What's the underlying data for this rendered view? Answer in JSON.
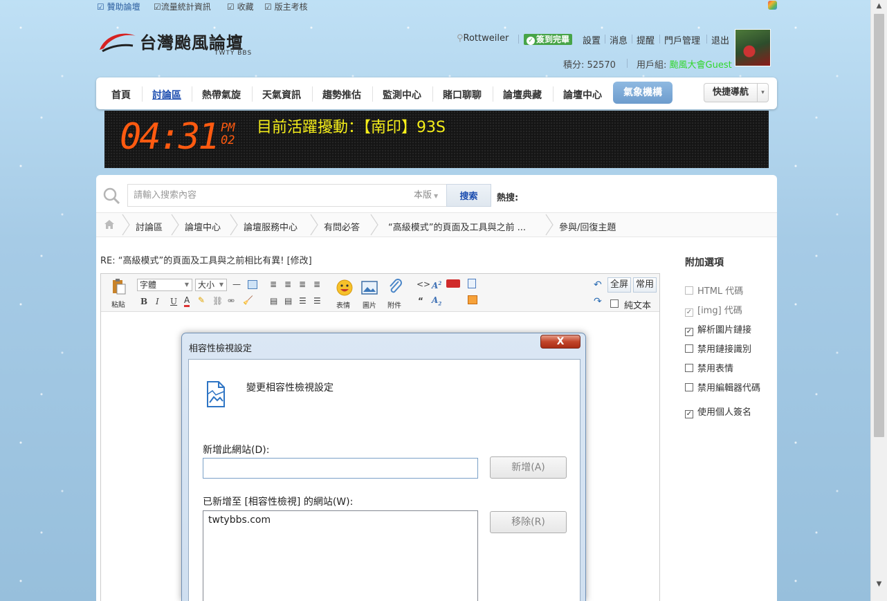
{
  "top_links": [
    {
      "label": "☑ 贊助論壇"
    },
    {
      "label": "☑流量統計資訊"
    },
    {
      "label": "☑ 收藏"
    },
    {
      "label": "☑ 版主考核"
    }
  ],
  "logo": {
    "title": "台灣颱風論壇",
    "subtitle": "TWTY BBS"
  },
  "user": {
    "name": "Rottweiler",
    "checkin": "簽到完畢",
    "links": [
      "設置",
      "消息",
      "提醒",
      "門戶管理",
      "退出"
    ],
    "points": "積分: 52570",
    "group_label": "用戶組: ",
    "group_value": "颱風大會Guest"
  },
  "nav": {
    "items": [
      "首頁",
      "討論區",
      "熱帶氣旋",
      "天氣資訊",
      "趨勢推估",
      "監測中心",
      "賭口聊聊",
      "論壇典藏",
      "論壇中心"
    ],
    "active": "討論區",
    "weather": "氣象機構",
    "quick": "快捷導航"
  },
  "banner": {
    "clock": "04:31",
    "ampm": "PM",
    "seconds": "02",
    "text": "目前活躍擾動：【南印】93S"
  },
  "search": {
    "placeholder": "請輸入搜索內容",
    "scope": "本版",
    "button": "搜索",
    "hot": "熱搜:"
  },
  "breadcrumb": [
    "討論區",
    "論壇中心",
    "論壇服務中心",
    "有問必答",
    "“高級模式”的頁面及工具與之前 ...",
    "參與/回復主題"
  ],
  "reply_title": "RE: “高級模式”的頁面及工具與之前相比有異! [修改]",
  "toolbar": {
    "paste": "粘貼",
    "font": "字體",
    "size": "大小",
    "emoji": "表情",
    "image": "圖片",
    "attach": "附件",
    "fullscreen": "全屏",
    "common": "常用",
    "plaintext": "純文本"
  },
  "options": {
    "title": "附加選項",
    "items": [
      {
        "label": "HTML 代碼",
        "checked": false,
        "disabled": true
      },
      {
        "label": "[img] 代碼",
        "checked": true,
        "disabled": true
      },
      {
        "label": "解析圖片鏈接",
        "checked": true,
        "disabled": false
      },
      {
        "label": "禁用鏈接識別",
        "checked": false,
        "disabled": false
      },
      {
        "label": "禁用表情",
        "checked": false,
        "disabled": false
      },
      {
        "label": "禁用編輯器代碼",
        "checked": false,
        "disabled": false
      },
      {
        "label": "使用個人簽名",
        "checked": true,
        "disabled": false
      }
    ]
  },
  "dialog": {
    "title": "相容性檢視設定",
    "heading": "變更相容性檢視設定",
    "add_label": "新增此網站(D):",
    "add_value": "",
    "add_button": "新增(A)",
    "list_label": "已新增至 [相容性檢視] 的網站(W):",
    "sites": [
      "twtybbs.com"
    ],
    "remove_button": "移除(R)",
    "close": "X"
  }
}
